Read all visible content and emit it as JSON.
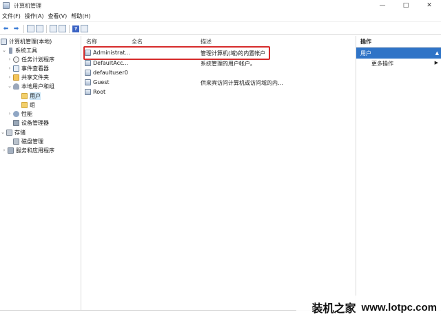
{
  "window": {
    "title": "计算机管理",
    "min_glyph": "—",
    "max_glyph": "□",
    "close_glyph": "✕"
  },
  "menu": [
    "文件(F)",
    "操作(A)",
    "查看(V)",
    "帮助(H)"
  ],
  "toolbar": {
    "back": "⬅",
    "forward": "➡",
    "help": "?"
  },
  "tree": [
    {
      "label": "计算机管理(本地)",
      "twisty": "",
      "icon": "computer-icon"
    },
    {
      "label": "系统工具",
      "twisty": "⌄",
      "icon": "tools-icon"
    },
    {
      "label": "任务计划程序",
      "twisty": "›",
      "icon": "clock-icon"
    },
    {
      "label": "事件查看器",
      "twisty": "›",
      "icon": "log-icon"
    },
    {
      "label": "共享文件夹",
      "twisty": "›",
      "icon": "share-icon"
    },
    {
      "label": "本地用户和组",
      "twisty": "⌄",
      "icon": "users-icon"
    },
    {
      "label": "用户",
      "twisty": "",
      "icon": "folder-icon"
    },
    {
      "label": "组",
      "twisty": "",
      "icon": "folder-icon"
    },
    {
      "label": "性能",
      "twisty": "›",
      "icon": "perf-icon"
    },
    {
      "label": "设备管理器",
      "twisty": "",
      "icon": "device-icon"
    },
    {
      "label": "存储",
      "twisty": "⌄",
      "icon": "storage-icon"
    },
    {
      "label": "磁盘管理",
      "twisty": "",
      "icon": "disk-icon"
    },
    {
      "label": "服务和应用程序",
      "twisty": "›",
      "icon": "services-icon"
    }
  ],
  "list": {
    "columns": [
      "名称",
      "全名",
      "描述"
    ],
    "rows": [
      {
        "name": "Administrat...",
        "fullname": "",
        "description": "管理计算机(域)的内置帐户"
      },
      {
        "name": "DefaultAcc...",
        "fullname": "",
        "description": "系统管理的用户帐户。"
      },
      {
        "name": "defaultuser0",
        "fullname": "",
        "description": ""
      },
      {
        "name": "Guest",
        "fullname": "",
        "description": "供来宾访问计算机或访问域的内..."
      },
      {
        "name": "Root",
        "fullname": "",
        "description": ""
      }
    ]
  },
  "actions": {
    "header": "操作",
    "section": "用户",
    "more": "更多操作",
    "caret_up": "▲",
    "caret_right": "▶"
  },
  "watermark": {
    "chinese": "装机之家",
    "url": "www.lotpc.com"
  },
  "colors": {
    "selection": "#2f74c7",
    "highlight_box": "#d62b2b",
    "tree_selected": "#cde6f7"
  }
}
